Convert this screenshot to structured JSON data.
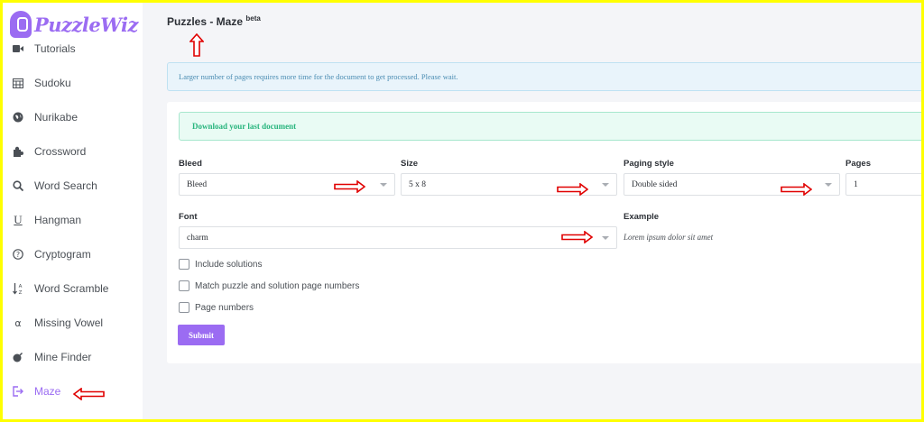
{
  "brand": {
    "name": "PuzzleWiz",
    "color": "#9b6cf2"
  },
  "sidebar": {
    "items": [
      {
        "label": "Tutorials",
        "icon": "video-icon"
      },
      {
        "label": "Sudoku",
        "icon": "calendar-grid-icon"
      },
      {
        "label": "Nurikabe",
        "icon": "globe-icon"
      },
      {
        "label": "Crossword",
        "icon": "puzzle-piece-icon"
      },
      {
        "label": "Word Search",
        "icon": "search-icon"
      },
      {
        "label": "Hangman",
        "icon": "underline-icon"
      },
      {
        "label": "Cryptogram",
        "icon": "question-circle-icon"
      },
      {
        "label": "Word Scramble",
        "icon": "sort-alpha-icon"
      },
      {
        "label": "Missing Vowel",
        "icon": "alpha-icon"
      },
      {
        "label": "Mine Finder",
        "icon": "bomb-icon"
      },
      {
        "label": "Maze",
        "icon": "sign-out-icon",
        "active": true
      }
    ]
  },
  "header": {
    "title": "Puzzles - Maze",
    "badge": "beta"
  },
  "info": {
    "message": "Larger number of pages requires more time for the document to get processed. Please wait."
  },
  "download": {
    "label": "Download your last document"
  },
  "form": {
    "bleed": {
      "label": "Bleed",
      "value": "Bleed"
    },
    "size": {
      "label": "Size",
      "value": "5 x 8"
    },
    "paging": {
      "label": "Paging style",
      "value": "Double sided"
    },
    "pages": {
      "label": "Pages",
      "value": "1"
    },
    "font": {
      "label": "Font",
      "value": "charm"
    },
    "example": {
      "label": "Example",
      "text": "Lorem ipsum dolor sit amet"
    },
    "checks": [
      {
        "label": "Include solutions",
        "checked": false
      },
      {
        "label": "Match puzzle and solution page numbers",
        "checked": false
      },
      {
        "label": "Page numbers",
        "checked": false
      }
    ],
    "submit_label": "Submit"
  },
  "annotation_color": "#e00000",
  "accent_color": "#9b6cf2"
}
